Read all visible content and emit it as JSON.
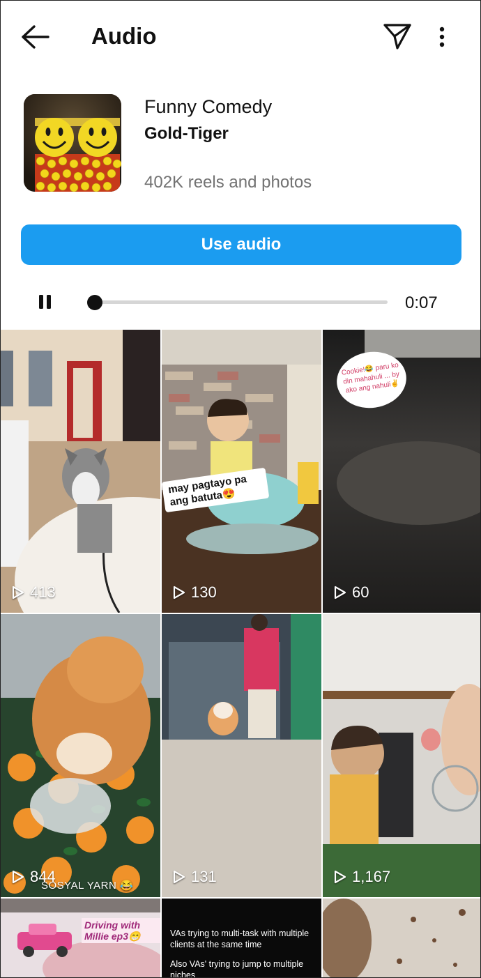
{
  "header": {
    "title": "Audio",
    "back_icon": "arrow-left-icon",
    "share_icon": "paper-plane-icon",
    "more_icon": "vertical-dots-icon"
  },
  "audio": {
    "title": "Funny Comedy",
    "artist": "Gold-Tiger",
    "reel_count": "402K reels and photos",
    "use_button": "Use audio"
  },
  "player": {
    "state_icon": "pause-icon",
    "progress": 0.0,
    "time": "0:07"
  },
  "grid": {
    "tiles": [
      {
        "views": "413"
      },
      {
        "views": "130",
        "caption": "may pagtayo pa ang batuta😍"
      },
      {
        "views": "60",
        "caption": "Cookie!😂 paru ko din mahahuli ... by ako ang nahuli✌️"
      },
      {
        "views": "844",
        "caption": "SOSYAL YARN 😂"
      },
      {
        "views": "131"
      },
      {
        "views": "1,167"
      },
      {
        "caption": "Driving with Millie ep3😁"
      },
      {
        "caption_lines": [
          "VAs trying to multi-task with multiple clients at the same time",
          "Also VAs' trying to jump to multiple niches"
        ]
      },
      {}
    ]
  },
  "colors": {
    "accent": "#1B9CF0",
    "text_primary": "#111111",
    "text_secondary": "#737373"
  }
}
